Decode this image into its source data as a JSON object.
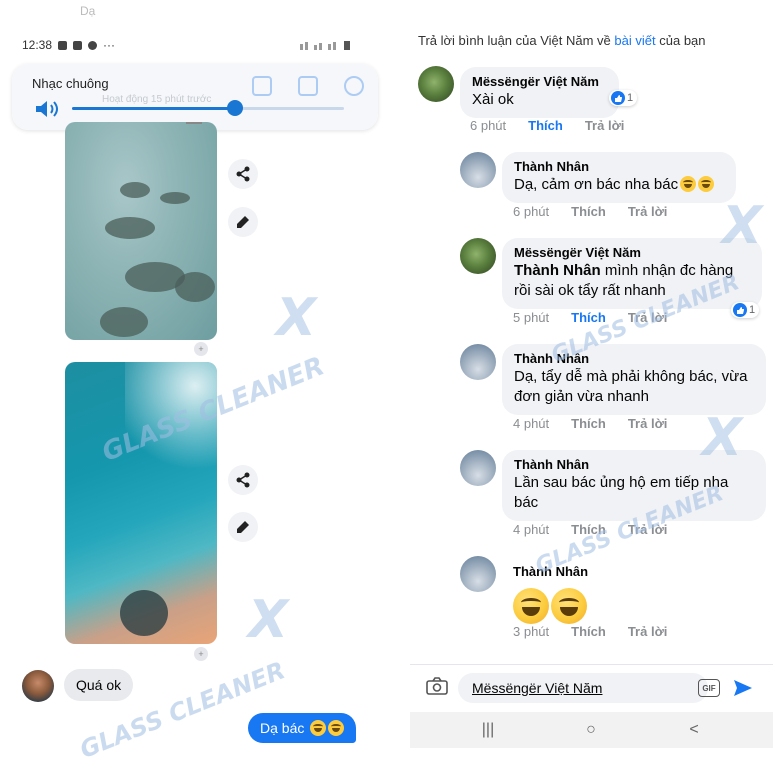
{
  "left": {
    "status_time": "12:38",
    "status_more": "···",
    "volume_label": "Nhạc chuông",
    "volume_level": 0.6,
    "faded_header_text": "Dạ",
    "faded_subtext": "Hoạt động 15 phút trước",
    "react_plus": "+",
    "messages": {
      "incoming": "Quá ok",
      "outgoing": "Dạ bác"
    }
  },
  "right": {
    "header": {
      "prefix": "Trả lời bình luận của Việt Năm về",
      "link": "bài viết",
      "suffix": "của bạn"
    },
    "comments": [
      {
        "name": "Mëssëngër Việt Năm",
        "text": "Xài ok",
        "time": "6 phút",
        "like": "Thích",
        "reply": "Trả lời",
        "reactions": "1"
      },
      {
        "name": "Thành Nhân",
        "text": "Dạ, cảm ơn bác nha bác",
        "time": "6 phút",
        "like": "Thích",
        "reply": "Trả lời"
      },
      {
        "name": "Mëssëngër Việt Năm",
        "mention": "Thành Nhân",
        "text": "mình nhận đc hàng rồi sài ok tẩy rất nhanh",
        "time": "5 phút",
        "like": "Thích",
        "reply": "Trả lời",
        "reactions": "1"
      },
      {
        "name": "Thành Nhân",
        "text": "Dạ, tẩy dễ mà phải không bác, vừa đơn giản vừa nhanh",
        "time": "4 phút",
        "like": "Thích",
        "reply": "Trả lời"
      },
      {
        "name": "Thành Nhân",
        "text": "Lần sau bác ủng hộ em tiếp nha bác",
        "time": "4 phút",
        "like": "Thích",
        "reply": "Trả lời"
      },
      {
        "name": "Thành Nhân",
        "text": "",
        "time": "3 phút",
        "like": "Thích",
        "reply": "Trả lời"
      }
    ],
    "composer": {
      "value": "Mëssëngër Việt Năm",
      "gif": "GIF"
    },
    "navbar": {
      "recents": "|||",
      "home": "○",
      "back": "<"
    }
  },
  "watermark": {
    "text": "GLASS CLEANER",
    "x": "X"
  },
  "colors": {
    "accent": "#1877f2",
    "bubble_in": "#e9eaee",
    "comment_bg": "#f0f2f5",
    "meta_gray": "#8a8d91"
  }
}
